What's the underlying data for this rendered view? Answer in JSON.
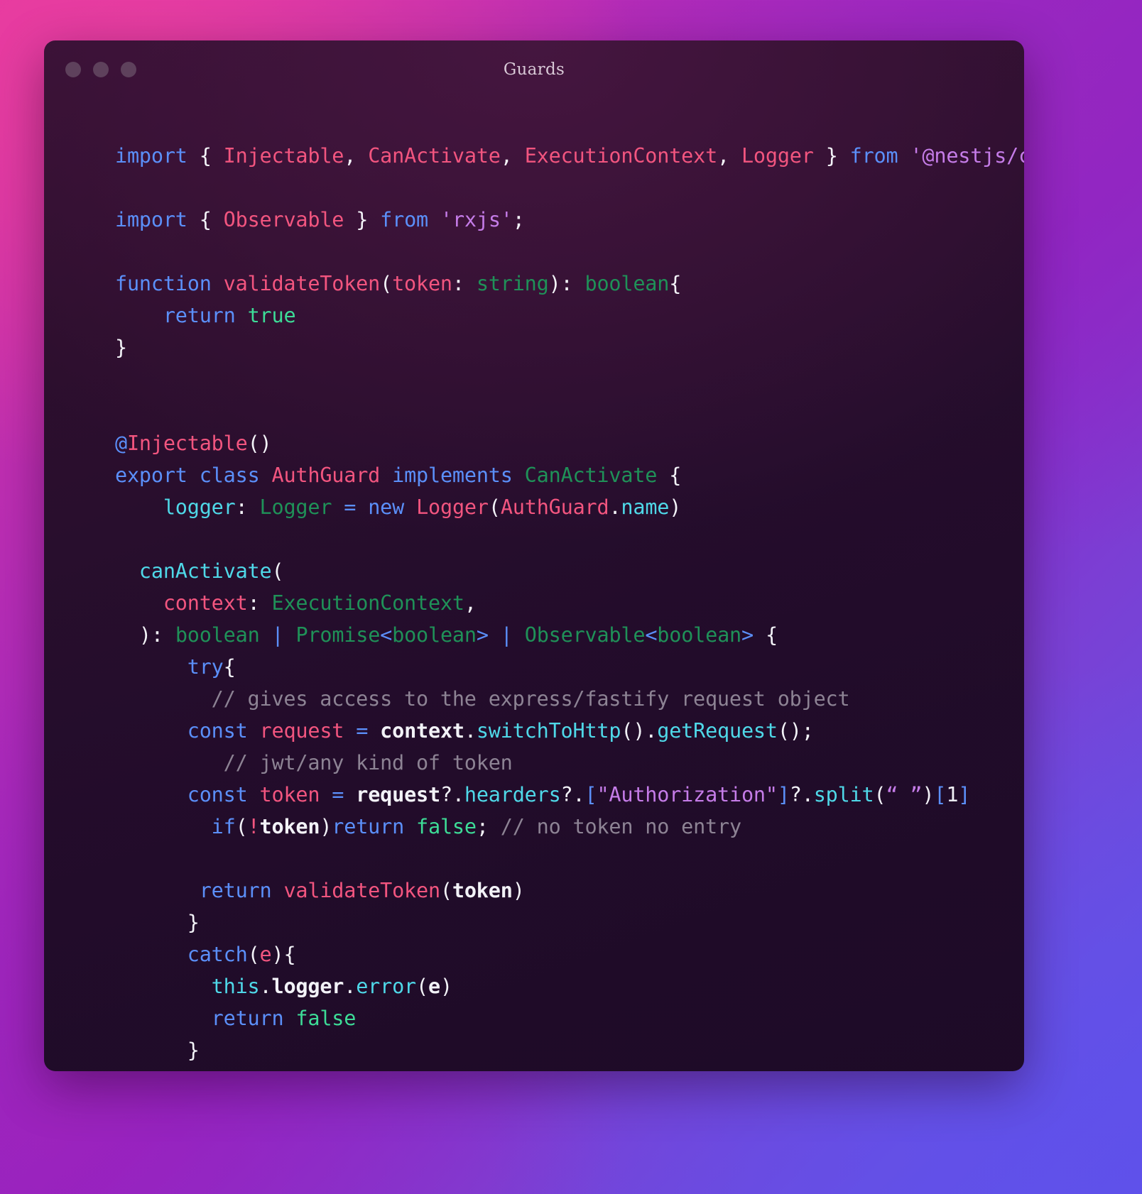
{
  "window": {
    "title": "Guards",
    "traffic_lights": [
      "close-dot",
      "minimize-dot",
      "maximize-dot"
    ],
    "background_gradient_start": "#e2359f",
    "background_gradient_end": "#5e57e8",
    "editor_background": "#2a0d2a"
  },
  "theme": {
    "keyword": "#5b8ff9",
    "identifier": "#f2557f",
    "string": "#c57ce8",
    "type": "#1f9158",
    "literal": "#3ddc97",
    "function": "#4fd8e8",
    "plain": "#f2f2f7",
    "comment": "#8d8394"
  },
  "code": {
    "language": "typescript",
    "filename": "Guards",
    "lines": [
      {
        "n": 1,
        "tokens": [
          {
            "t": "import",
            "c": "kw"
          },
          {
            "t": " ",
            "c": "pl"
          },
          {
            "t": "{",
            "c": "pl"
          },
          {
            "t": " ",
            "c": "pl"
          },
          {
            "t": "Injectable",
            "c": "id"
          },
          {
            "t": ",",
            "c": "pl"
          },
          {
            "t": " ",
            "c": "pl"
          },
          {
            "t": "CanActivate",
            "c": "id"
          },
          {
            "t": ",",
            "c": "pl"
          },
          {
            "t": " ",
            "c": "pl"
          },
          {
            "t": "ExecutionContext",
            "c": "id"
          },
          {
            "t": ",",
            "c": "pl"
          },
          {
            "t": " ",
            "c": "pl"
          },
          {
            "t": "Logger",
            "c": "id"
          },
          {
            "t": " ",
            "c": "pl"
          },
          {
            "t": "}",
            "c": "pl"
          },
          {
            "t": " ",
            "c": "pl"
          },
          {
            "t": "from",
            "c": "kw"
          },
          {
            "t": " ",
            "c": "pl"
          },
          {
            "t": "'@nestjs/common'",
            "c": "str"
          },
          {
            "t": ";",
            "c": "pl"
          }
        ]
      },
      {
        "n": 2,
        "tokens": []
      },
      {
        "n": 3,
        "tokens": [
          {
            "t": "import",
            "c": "kw"
          },
          {
            "t": " ",
            "c": "pl"
          },
          {
            "t": "{",
            "c": "pl"
          },
          {
            "t": " ",
            "c": "pl"
          },
          {
            "t": "Observable",
            "c": "id"
          },
          {
            "t": " ",
            "c": "pl"
          },
          {
            "t": "}",
            "c": "pl"
          },
          {
            "t": " ",
            "c": "pl"
          },
          {
            "t": "from",
            "c": "kw"
          },
          {
            "t": " ",
            "c": "pl"
          },
          {
            "t": "'rxjs'",
            "c": "str"
          },
          {
            "t": ";",
            "c": "pl"
          }
        ]
      },
      {
        "n": 4,
        "tokens": []
      },
      {
        "n": 5,
        "tokens": [
          {
            "t": "function",
            "c": "kw"
          },
          {
            "t": " ",
            "c": "pl"
          },
          {
            "t": "validateToken",
            "c": "id"
          },
          {
            "t": "(",
            "c": "pl"
          },
          {
            "t": "token",
            "c": "id"
          },
          {
            "t": ":",
            "c": "pl"
          },
          {
            "t": " ",
            "c": "pl"
          },
          {
            "t": "string",
            "c": "typ"
          },
          {
            "t": ")",
            "c": "pl"
          },
          {
            "t": ":",
            "c": "pl"
          },
          {
            "t": " ",
            "c": "pl"
          },
          {
            "t": "boolean",
            "c": "typ"
          },
          {
            "t": "{",
            "c": "pl"
          }
        ]
      },
      {
        "n": 6,
        "tokens": [
          {
            "t": "    ",
            "c": "pl"
          },
          {
            "t": "return",
            "c": "kw"
          },
          {
            "t": " ",
            "c": "pl"
          },
          {
            "t": "true",
            "c": "lit"
          }
        ]
      },
      {
        "n": 7,
        "tokens": [
          {
            "t": "}",
            "c": "pl"
          }
        ]
      },
      {
        "n": 8,
        "tokens": []
      },
      {
        "n": 9,
        "tokens": []
      },
      {
        "n": 10,
        "tokens": [
          {
            "t": "@",
            "c": "op"
          },
          {
            "t": "Injectable",
            "c": "id"
          },
          {
            "t": "()",
            "c": "pl"
          }
        ]
      },
      {
        "n": 11,
        "tokens": [
          {
            "t": "export",
            "c": "kw"
          },
          {
            "t": " ",
            "c": "pl"
          },
          {
            "t": "class",
            "c": "kw"
          },
          {
            "t": " ",
            "c": "pl"
          },
          {
            "t": "AuthGuard",
            "c": "id"
          },
          {
            "t": " ",
            "c": "pl"
          },
          {
            "t": "implements",
            "c": "kw"
          },
          {
            "t": " ",
            "c": "pl"
          },
          {
            "t": "CanActivate",
            "c": "typ"
          },
          {
            "t": " ",
            "c": "pl"
          },
          {
            "t": "{",
            "c": "pl"
          }
        ]
      },
      {
        "n": 12,
        "tokens": [
          {
            "t": "    ",
            "c": "pl"
          },
          {
            "t": "logger",
            "c": "fn"
          },
          {
            "t": ":",
            "c": "pl"
          },
          {
            "t": " ",
            "c": "pl"
          },
          {
            "t": "Logger",
            "c": "typ"
          },
          {
            "t": " ",
            "c": "pl"
          },
          {
            "t": "=",
            "c": "op"
          },
          {
            "t": " ",
            "c": "pl"
          },
          {
            "t": "new",
            "c": "kw"
          },
          {
            "t": " ",
            "c": "pl"
          },
          {
            "t": "Logger",
            "c": "id"
          },
          {
            "t": "(",
            "c": "pl"
          },
          {
            "t": "AuthGuard",
            "c": "id"
          },
          {
            "t": ".",
            "c": "pl"
          },
          {
            "t": "name",
            "c": "fn"
          },
          {
            "t": ")",
            "c": "pl"
          }
        ]
      },
      {
        "n": 13,
        "tokens": []
      },
      {
        "n": 14,
        "tokens": [
          {
            "t": "  ",
            "c": "pl"
          },
          {
            "t": "canActivate",
            "c": "fn"
          },
          {
            "t": "(",
            "c": "pl"
          }
        ]
      },
      {
        "n": 15,
        "tokens": [
          {
            "t": "    ",
            "c": "pl"
          },
          {
            "t": "context",
            "c": "id"
          },
          {
            "t": ":",
            "c": "pl"
          },
          {
            "t": " ",
            "c": "pl"
          },
          {
            "t": "ExecutionContext",
            "c": "typ"
          },
          {
            "t": ",",
            "c": "pl"
          }
        ]
      },
      {
        "n": 16,
        "tokens": [
          {
            "t": "  ",
            "c": "pl"
          },
          {
            "t": ")",
            "c": "pl"
          },
          {
            "t": ":",
            "c": "pl"
          },
          {
            "t": " ",
            "c": "pl"
          },
          {
            "t": "boolean",
            "c": "typ"
          },
          {
            "t": " ",
            "c": "pl"
          },
          {
            "t": "|",
            "c": "op"
          },
          {
            "t": " ",
            "c": "pl"
          },
          {
            "t": "Promise",
            "c": "typ"
          },
          {
            "t": "<",
            "c": "op"
          },
          {
            "t": "boolean",
            "c": "typ"
          },
          {
            "t": ">",
            "c": "op"
          },
          {
            "t": " ",
            "c": "pl"
          },
          {
            "t": "|",
            "c": "op"
          },
          {
            "t": " ",
            "c": "pl"
          },
          {
            "t": "Observable",
            "c": "typ"
          },
          {
            "t": "<",
            "c": "op"
          },
          {
            "t": "boolean",
            "c": "typ"
          },
          {
            "t": ">",
            "c": "op"
          },
          {
            "t": " ",
            "c": "pl"
          },
          {
            "t": "{",
            "c": "pl"
          }
        ]
      },
      {
        "n": 17,
        "tokens": [
          {
            "t": "      ",
            "c": "pl"
          },
          {
            "t": "try",
            "c": "kw"
          },
          {
            "t": "{",
            "c": "pl"
          }
        ]
      },
      {
        "n": 18,
        "tokens": [
          {
            "t": "        ",
            "c": "pl"
          },
          {
            "t": "// gives access to the express/fastify request object",
            "c": "cm"
          }
        ]
      },
      {
        "n": 19,
        "tokens": [
          {
            "t": "      ",
            "c": "pl"
          },
          {
            "t": "const",
            "c": "kw"
          },
          {
            "t": " ",
            "c": "pl"
          },
          {
            "t": "request",
            "c": "id"
          },
          {
            "t": " ",
            "c": "pl"
          },
          {
            "t": "=",
            "c": "op"
          },
          {
            "t": " ",
            "c": "pl"
          },
          {
            "t": "context",
            "c": "pl bold"
          },
          {
            "t": ".",
            "c": "pl"
          },
          {
            "t": "switchToHttp",
            "c": "fn"
          },
          {
            "t": "()",
            "c": "pl"
          },
          {
            "t": ".",
            "c": "pl"
          },
          {
            "t": "getRequest",
            "c": "fn"
          },
          {
            "t": "()",
            "c": "pl"
          },
          {
            "t": ";",
            "c": "pl"
          }
        ]
      },
      {
        "n": 20,
        "tokens": [
          {
            "t": "         ",
            "c": "pl"
          },
          {
            "t": "// jwt/any kind of token",
            "c": "cm"
          }
        ]
      },
      {
        "n": 21,
        "tokens": [
          {
            "t": "      ",
            "c": "pl"
          },
          {
            "t": "const",
            "c": "kw"
          },
          {
            "t": " ",
            "c": "pl"
          },
          {
            "t": "token",
            "c": "id"
          },
          {
            "t": " ",
            "c": "pl"
          },
          {
            "t": "=",
            "c": "op"
          },
          {
            "t": " ",
            "c": "pl"
          },
          {
            "t": "request",
            "c": "pl bold"
          },
          {
            "t": "?.",
            "c": "pl"
          },
          {
            "t": "hearders",
            "c": "fn"
          },
          {
            "t": "?.",
            "c": "pl"
          },
          {
            "t": "[",
            "c": "op"
          },
          {
            "t": "\"Authorization\"",
            "c": "str"
          },
          {
            "t": "]",
            "c": "op"
          },
          {
            "t": "?.",
            "c": "pl"
          },
          {
            "t": "split",
            "c": "fn"
          },
          {
            "t": "(",
            "c": "pl"
          },
          {
            "t": "“ ”",
            "c": "str"
          },
          {
            "t": ")",
            "c": "pl"
          },
          {
            "t": "[",
            "c": "op"
          },
          {
            "t": "1",
            "c": "pl"
          },
          {
            "t": "]",
            "c": "op"
          }
        ]
      },
      {
        "n": 22,
        "tokens": [
          {
            "t": "        ",
            "c": "pl"
          },
          {
            "t": "if",
            "c": "kw"
          },
          {
            "t": "(",
            "c": "pl"
          },
          {
            "t": "!",
            "c": "id"
          },
          {
            "t": "token",
            "c": "pl bold"
          },
          {
            "t": ")",
            "c": "pl"
          },
          {
            "t": "return",
            "c": "kw"
          },
          {
            "t": " ",
            "c": "pl"
          },
          {
            "t": "false",
            "c": "lit"
          },
          {
            "t": ";",
            "c": "pl"
          },
          {
            "t": " ",
            "c": "pl"
          },
          {
            "t": "// no token no entry",
            "c": "cm"
          }
        ]
      },
      {
        "n": 23,
        "tokens": []
      },
      {
        "n": 24,
        "tokens": [
          {
            "t": "       ",
            "c": "pl"
          },
          {
            "t": "return",
            "c": "kw"
          },
          {
            "t": " ",
            "c": "pl"
          },
          {
            "t": "validateToken",
            "c": "id"
          },
          {
            "t": "(",
            "c": "pl"
          },
          {
            "t": "token",
            "c": "pl bold"
          },
          {
            "t": ")",
            "c": "pl"
          }
        ]
      },
      {
        "n": 25,
        "tokens": [
          {
            "t": "      ",
            "c": "pl"
          },
          {
            "t": "}",
            "c": "pl"
          }
        ]
      },
      {
        "n": 26,
        "tokens": [
          {
            "t": "      ",
            "c": "pl"
          },
          {
            "t": "catch",
            "c": "kw"
          },
          {
            "t": "(",
            "c": "pl"
          },
          {
            "t": "e",
            "c": "id"
          },
          {
            "t": ")",
            "c": "pl"
          },
          {
            "t": "{",
            "c": "pl"
          }
        ]
      },
      {
        "n": 27,
        "tokens": [
          {
            "t": "        ",
            "c": "pl"
          },
          {
            "t": "this",
            "c": "fn"
          },
          {
            "t": ".",
            "c": "pl"
          },
          {
            "t": "logger",
            "c": "pl bold"
          },
          {
            "t": ".",
            "c": "pl"
          },
          {
            "t": "error",
            "c": "fn"
          },
          {
            "t": "(",
            "c": "pl"
          },
          {
            "t": "e",
            "c": "pl bold"
          },
          {
            "t": ")",
            "c": "pl"
          }
        ]
      },
      {
        "n": 28,
        "tokens": [
          {
            "t": "        ",
            "c": "pl"
          },
          {
            "t": "return",
            "c": "kw"
          },
          {
            "t": " ",
            "c": "pl"
          },
          {
            "t": "false",
            "c": "lit"
          }
        ]
      },
      {
        "n": 29,
        "tokens": [
          {
            "t": "      ",
            "c": "pl"
          },
          {
            "t": "}",
            "c": "pl"
          }
        ]
      },
      {
        "n": 30,
        "tokens": [
          {
            "t": "  ",
            "c": "pl"
          },
          {
            "t": "}",
            "c": "pl"
          }
        ]
      },
      {
        "n": 31,
        "tokens": [
          {
            "t": "}",
            "c": "pl"
          }
        ]
      }
    ]
  }
}
